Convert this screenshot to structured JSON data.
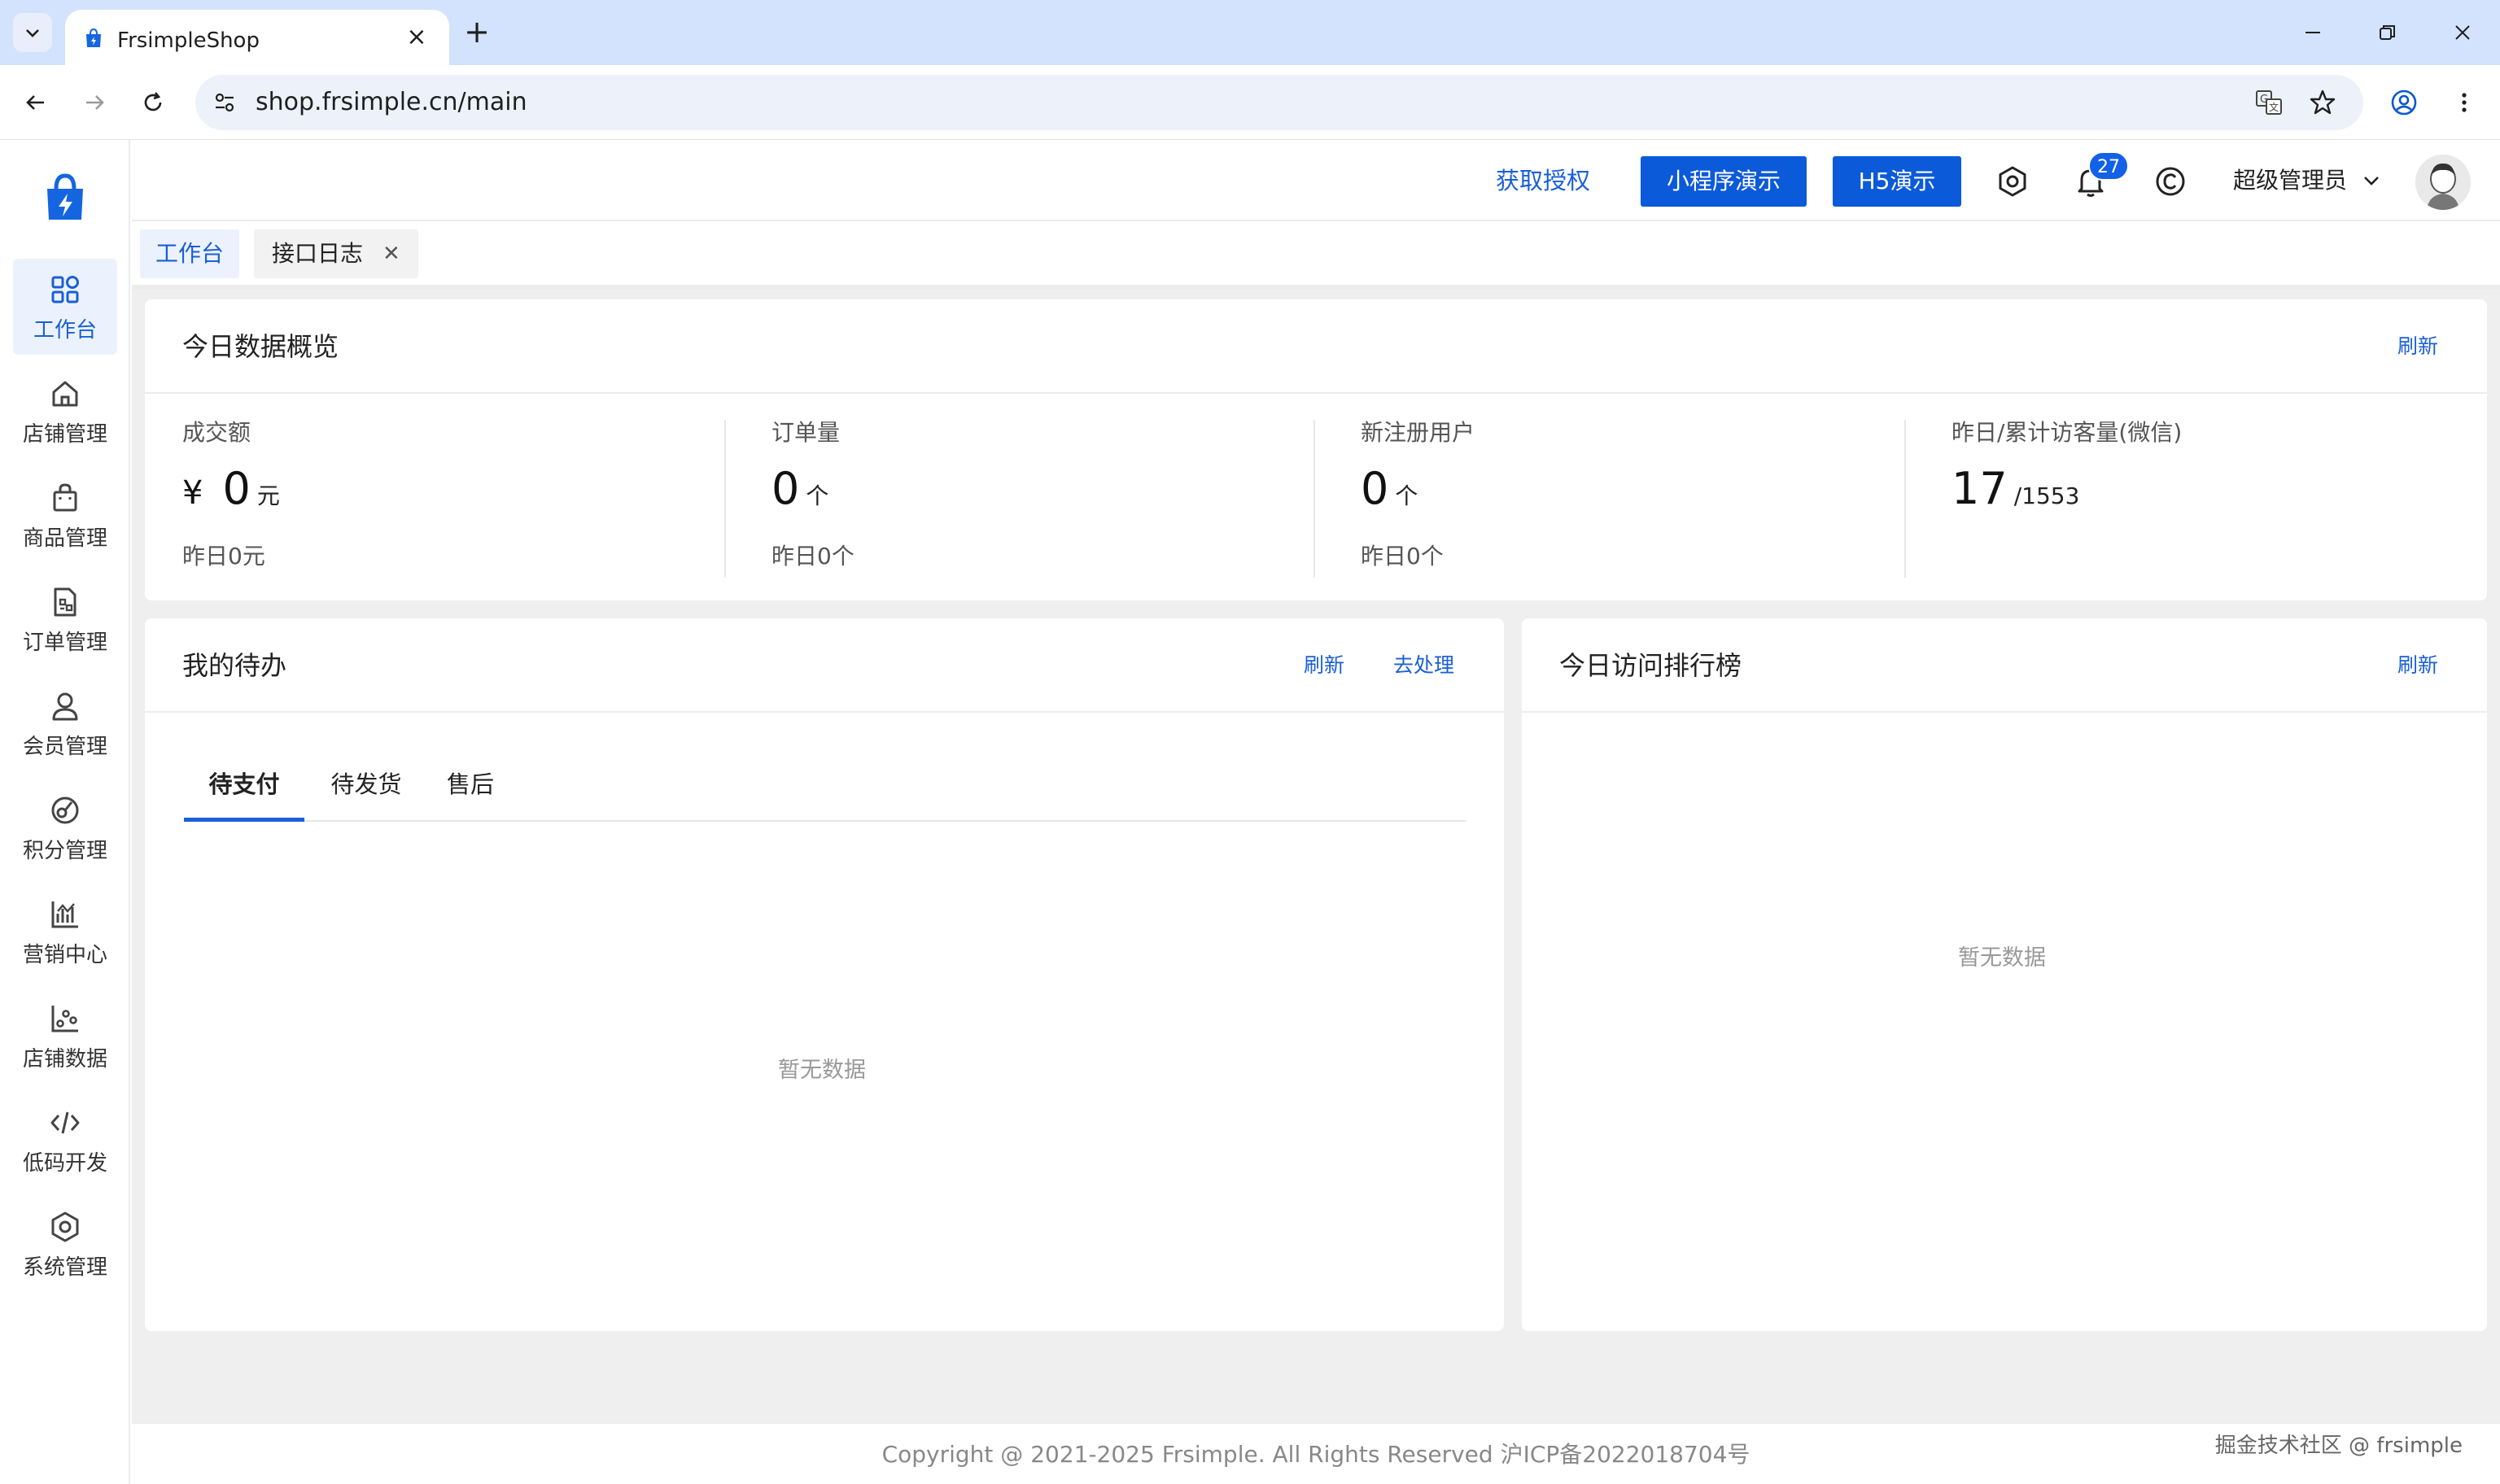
{
  "browser": {
    "tab_title": "FrsimpleShop",
    "url": "shop.frsimple.cn/main"
  },
  "sidebar": {
    "items": [
      {
        "label": "工作台",
        "icon": "dashboard-icon"
      },
      {
        "label": "店铺管理",
        "icon": "store-icon"
      },
      {
        "label": "商品管理",
        "icon": "shopping-bag-icon"
      },
      {
        "label": "订单管理",
        "icon": "order-document-icon"
      },
      {
        "label": "会员管理",
        "icon": "member-user-icon"
      },
      {
        "label": "积分管理",
        "icon": "points-icon"
      },
      {
        "label": "营销中心",
        "icon": "marketing-chart-icon"
      },
      {
        "label": "店铺数据",
        "icon": "data-scatter-icon"
      },
      {
        "label": "低码开发",
        "icon": "code-icon"
      },
      {
        "label": "系统管理",
        "icon": "settings-hexagon-icon"
      }
    ]
  },
  "header": {
    "auth_link": "获取授权",
    "miniapp_button": "小程序演示",
    "h5_button": "H5演示",
    "notification_count": "27",
    "user_name": "超级管理员"
  },
  "tags": {
    "active": "工作台",
    "other": "接口日志"
  },
  "overview": {
    "title": "今日数据概览",
    "refresh": "刷新",
    "stats": [
      {
        "label": "成交额",
        "prefix": "¥",
        "value": "0",
        "unit": "元",
        "sub": "昨日0元"
      },
      {
        "label": "订单量",
        "prefix": "",
        "value": "0",
        "unit": "个",
        "sub": "昨日0个"
      },
      {
        "label": "新注册用户",
        "prefix": "",
        "value": "0",
        "unit": "个",
        "sub": "昨日0个"
      },
      {
        "label": "昨日/累计访客量(微信)",
        "prefix": "",
        "value": "17",
        "unit": "/1553",
        "sub": ""
      }
    ]
  },
  "todo": {
    "title": "我的待办",
    "refresh": "刷新",
    "process": "去处理",
    "tabs": [
      "待支付",
      "待发货",
      "售后"
    ],
    "empty": "暂无数据"
  },
  "ranking": {
    "title": "今日访问排行榜",
    "refresh": "刷新",
    "empty": "暂无数据"
  },
  "footer": {
    "copyright": "Copyright @ 2021-2025 Frsimple. All Rights Reserved 沪ICP备2022018704号",
    "watermark": "掘金技术社区 @ frsimple"
  },
  "colors": {
    "accent": "#1a5fd6",
    "button": "#0b5ad9",
    "chrome_tabstrip": "#d3e3fd",
    "content_bg": "#efefef"
  }
}
